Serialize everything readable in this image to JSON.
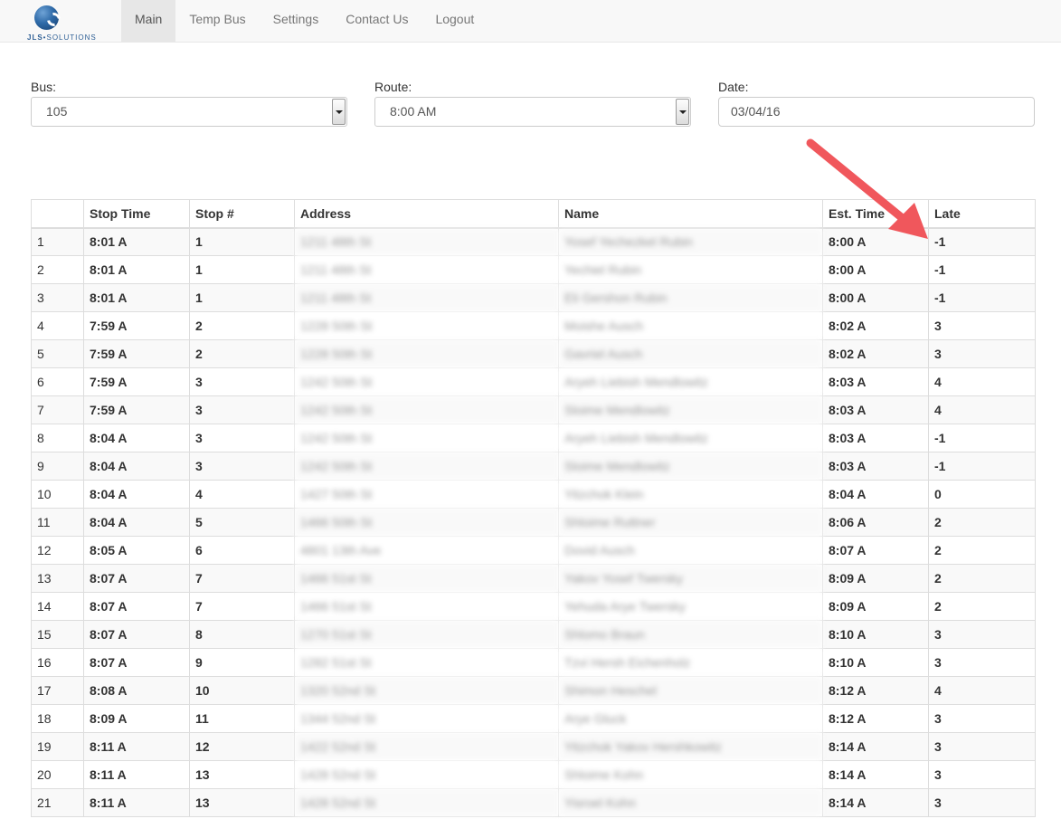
{
  "brand": {
    "text_bold": "JLS",
    "text_rest": "SOLUTIONS"
  },
  "nav": {
    "items": [
      "Main",
      "Temp Bus",
      "Settings",
      "Contact Us",
      "Logout"
    ],
    "active": "Main"
  },
  "filters": {
    "bus": {
      "label": "Bus:",
      "value": "105"
    },
    "route": {
      "label": "Route:",
      "value": "8:00 AM"
    },
    "date": {
      "label": "Date:",
      "value": "03/04/16"
    }
  },
  "annotation": {
    "color": "#f0575c",
    "icon": "arrow-icon"
  },
  "table": {
    "headers": [
      "",
      "Stop Time",
      "Stop #",
      "Address",
      "Name",
      "Est. Time",
      "Late"
    ],
    "rows": [
      [
        "1",
        "8:01 A",
        "1",
        "1211 48th St",
        "Yosef Yechezkel Rubin",
        "8:00 A",
        "-1"
      ],
      [
        "2",
        "8:01 A",
        "1",
        "1211 48th St",
        "Yechiel Rubin",
        "8:00 A",
        "-1"
      ],
      [
        "3",
        "8:01 A",
        "1",
        "1211 48th St",
        "Eli Gershon Rubin",
        "8:00 A",
        "-1"
      ],
      [
        "4",
        "7:59 A",
        "2",
        "1228 50th St",
        "Moishe Ausch",
        "8:02 A",
        "3"
      ],
      [
        "5",
        "7:59 A",
        "2",
        "1228 50th St",
        "Gavriel Ausch",
        "8:02 A",
        "3"
      ],
      [
        "6",
        "7:59 A",
        "3",
        "1242 50th St",
        "Aryeh Liebish Mendlowitz",
        "8:03 A",
        "4"
      ],
      [
        "7",
        "7:59 A",
        "3",
        "1242 50th St",
        "Sloime Mendlowitz",
        "8:03 A",
        "4"
      ],
      [
        "8",
        "8:04 A",
        "3",
        "1242 50th St",
        "Aryeh Liebish Mendlowitz",
        "8:03 A",
        "-1"
      ],
      [
        "9",
        "8:04 A",
        "3",
        "1242 50th St",
        "Sloime Mendlowitz",
        "8:03 A",
        "-1"
      ],
      [
        "10",
        "8:04 A",
        "4",
        "1427 50th St",
        "Yitzchok Klein",
        "8:04 A",
        "0"
      ],
      [
        "11",
        "8:04 A",
        "5",
        "1466 50th St",
        "Shloime Ruttner",
        "8:06 A",
        "2"
      ],
      [
        "12",
        "8:05 A",
        "6",
        "4801 13th Ave",
        "Dovid Ausch",
        "8:07 A",
        "2"
      ],
      [
        "13",
        "8:07 A",
        "7",
        "1466 51st St",
        "Yakov Yosef Twersky",
        "8:09 A",
        "2"
      ],
      [
        "14",
        "8:07 A",
        "7",
        "1466 51st St",
        "Yehuda Arye Twersky",
        "8:09 A",
        "2"
      ],
      [
        "15",
        "8:07 A",
        "8",
        "1270 51st St",
        "Shlomo Braun",
        "8:10 A",
        "3"
      ],
      [
        "16",
        "8:07 A",
        "9",
        "1282 51st St",
        "Tzvi Hersh Eichenholz",
        "8:10 A",
        "3"
      ],
      [
        "17",
        "8:08 A",
        "10",
        "1320 52nd St",
        "Shimon Heschel",
        "8:12 A",
        "4"
      ],
      [
        "18",
        "8:09 A",
        "11",
        "1344 52nd St",
        "Arye Gluck",
        "8:12 A",
        "3"
      ],
      [
        "19",
        "8:11 A",
        "12",
        "1422 52nd St",
        "Yitzchok Yakov Hershkowitz",
        "8:14 A",
        "3"
      ],
      [
        "20",
        "8:11 A",
        "13",
        "1428 52nd St",
        "Shloime Kohn",
        "8:14 A",
        "3"
      ],
      [
        "21",
        "8:11 A",
        "13",
        "1428 52nd St",
        "Yisroel Kohn",
        "8:14 A",
        "3"
      ]
    ]
  }
}
